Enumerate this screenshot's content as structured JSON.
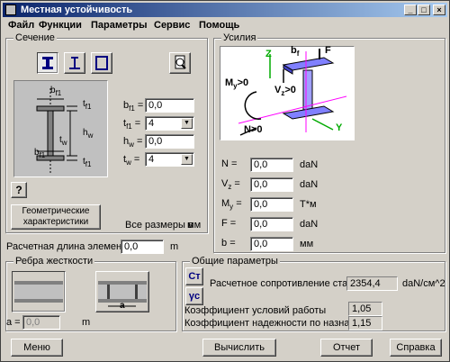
{
  "window": {
    "title": "Местная устойчивость",
    "controls": [
      "_",
      "□",
      "×"
    ]
  },
  "menu": [
    "Файл",
    "Функции",
    "Параметры",
    "Сервис",
    "Помощь"
  ],
  "section": {
    "label": "Сечение",
    "fields": [
      {
        "name": "bf1",
        "label": "b",
        "sub": "f1",
        "value": "0,0",
        "kind": "input"
      },
      {
        "name": "tf1",
        "label": "t",
        "sub": "f1",
        "value": "4",
        "kind": "select"
      },
      {
        "name": "hw",
        "label": "h",
        "sub": "w",
        "value": "0,0",
        "kind": "input"
      },
      {
        "name": "tw",
        "label": "t",
        "sub": "w",
        "value": "4",
        "kind": "select"
      }
    ],
    "diagram_labels": {
      "bf1_top": "b",
      "bf1_top_sub": "f1",
      "tf1_top": "t",
      "tf1_top_sub": "f1",
      "hw": "h",
      "hw_sub": "w",
      "tw": "t",
      "tw_sub": "w",
      "bf1_bot": "b",
      "bf1_bot_sub": "f1",
      "tf1_bot": "t",
      "tf1_bot_sub": "f1"
    },
    "help_label": "?",
    "geom_button": "Геометрические характеристики",
    "units_text": "Все размеры в",
    "units_value": "мм"
  },
  "forces": {
    "label": "Усилия",
    "diagram_labels": {
      "b": "b",
      "b_sub": "f",
      "F": "F",
      "Z": "Z",
      "My": "M",
      "My_sub": "y",
      "My_suffix": ">0",
      "Vz": "V",
      "Vz_sub": "z",
      "Vz_suffix": ">0",
      "N": "N>0",
      "Y": "Y"
    },
    "rows": [
      {
        "label": "N",
        "sub": "",
        "eq": "=",
        "value": "0,0",
        "unit": "daN"
      },
      {
        "label": "V",
        "sub": "z",
        "eq": "=",
        "value": "0,0",
        "unit": "daN"
      },
      {
        "label": "M",
        "sub": "y",
        "eq": "=",
        "value": "0,0",
        "unit": "T*м"
      },
      {
        "label": "F",
        "sub": "",
        "eq": "=",
        "value": "0,0",
        "unit": "daN"
      },
      {
        "label": "b",
        "sub": "",
        "eq": "=",
        "value": "0,0",
        "unit": "мм"
      }
    ]
  },
  "length": {
    "label": "Расчетная длина элемента L =",
    "value": "0,0",
    "unit": "m"
  },
  "stiffeners": {
    "label": "Ребра жесткости",
    "a_label": "a =",
    "a_value": "0,0",
    "a_unit": "m",
    "diagram_a": "a"
  },
  "general": {
    "label": "Общие параметры",
    "st_button": "Ст",
    "yc_button": "γc",
    "resistance_label": "Расчетное сопротивление стали Ry",
    "resistance_value": "2354,4",
    "resistance_unit": "daN/cм^2",
    "work_label": "Коэффициент условий работы",
    "work_value": "1,05",
    "rel_label": "Коэффициент надежности по назначению",
    "rel_value": "1,15"
  },
  "buttons": {
    "menu": "Меню",
    "calc": "Вычислить",
    "report": "Отчет",
    "help": "Справка"
  }
}
